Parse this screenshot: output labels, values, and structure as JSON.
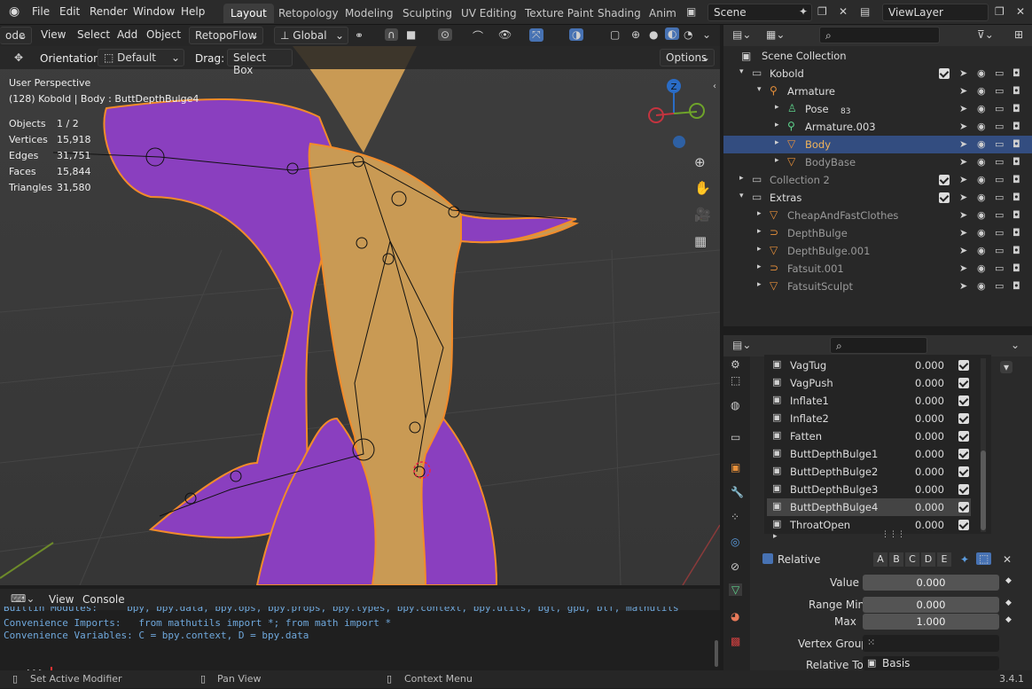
{
  "topbar": {
    "menus": [
      "File",
      "Edit",
      "Render",
      "Window",
      "Help"
    ],
    "workspaces": [
      "Layout",
      "Retopology",
      "Modeling",
      "Sculpting",
      "UV Editing",
      "Texture Paint",
      "Shading",
      "Anim"
    ],
    "active_workspace": "Layout",
    "scene": "Scene",
    "view_layer": "ViewLayer"
  },
  "viewport_header": {
    "mode": "ode",
    "view": "View",
    "select": "Select",
    "add": "Add",
    "object": "Object",
    "addon": "RetopoFlow",
    "transform_orientation": "Global"
  },
  "tool_settings": {
    "orientation_label": "Orientation:",
    "orientation_value": "Default",
    "drag_label": "Drag:",
    "drag_value": "Select Box",
    "options": "Options"
  },
  "viewport": {
    "perspective": "User Perspective",
    "context": "(128) Kobold | Body : ButtDepthBulge4",
    "stats": [
      {
        "label": "Objects",
        "value": "1 / 2"
      },
      {
        "label": "Vertices",
        "value": "15,918"
      },
      {
        "label": "Edges",
        "value": "31,751"
      },
      {
        "label": "Faces",
        "value": "15,844"
      },
      {
        "label": "Triangles",
        "value": "31,580"
      }
    ],
    "gizmo_axis": "Z"
  },
  "outliner": {
    "root": "Scene Collection",
    "rows": [
      {
        "label": "Kobold",
        "indent": 1,
        "icon": "collection-icon"
      },
      {
        "label": "Armature",
        "indent": 2,
        "icon": "armature-icon"
      },
      {
        "label": "Pose",
        "indent": 3,
        "icon": "pose-icon",
        "badge": "83"
      },
      {
        "label": "Armature.003",
        "indent": 3,
        "icon": "armature-data-icon"
      },
      {
        "label": "Body",
        "indent": 3,
        "icon": "mesh-icon",
        "selected": true
      },
      {
        "label": "BodyBase",
        "indent": 3,
        "icon": "mesh-icon"
      },
      {
        "label": "Collection 2",
        "indent": 1,
        "icon": "collection-icon"
      },
      {
        "label": "Extras",
        "indent": 1,
        "icon": "collection-icon"
      },
      {
        "label": "CheapAndFastClothes",
        "indent": 2,
        "icon": "mesh-icon"
      },
      {
        "label": "DepthBulge",
        "indent": 2,
        "icon": "curve-icon"
      },
      {
        "label": "DepthBulge.001",
        "indent": 2,
        "icon": "mesh-icon"
      },
      {
        "label": "Fatsuit.001",
        "indent": 2,
        "icon": "curve-icon"
      },
      {
        "label": "FatsuitSculpt",
        "indent": 2,
        "icon": "mesh-icon"
      }
    ]
  },
  "shape_keys": {
    "rows": [
      {
        "name": "VagTug",
        "value": "0.000"
      },
      {
        "name": "VagPush",
        "value": "0.000"
      },
      {
        "name": "Inflate1",
        "value": "0.000"
      },
      {
        "name": "Inflate2",
        "value": "0.000"
      },
      {
        "name": "Fatten",
        "value": "0.000"
      },
      {
        "name": "ButtDepthBulge1",
        "value": "0.000"
      },
      {
        "name": "ButtDepthBulge2",
        "value": "0.000"
      },
      {
        "name": "ButtDepthBulge3",
        "value": "0.000"
      },
      {
        "name": "ButtDepthBulge4",
        "value": "0.000",
        "selected": true
      },
      {
        "name": "ThroatOpen",
        "value": "0.000"
      }
    ],
    "relative_label": "Relative",
    "letters": [
      "A",
      "B",
      "C",
      "D",
      "E"
    ],
    "value_label": "Value",
    "value": "0.000",
    "range_min_label": "Range Min",
    "range_min": "0.000",
    "max_label": "Max",
    "max": "1.000",
    "vertex_group_label": "Vertex Group",
    "relative_to_label": "Relative To",
    "relative_to": "Basis"
  },
  "console": {
    "view": "View",
    "console": "Console",
    "lines": [
      "Builtin Modules:     bpy, bpy.data, bpy.ops, bpy.props, bpy.types, bpy.context, bpy.utils, bgl, gpu, blf, mathutils",
      "Convenience Imports:   from mathutils import *; from math import *",
      "Convenience Variables: C = bpy.context, D = bpy.data"
    ],
    "prompt": ">>> "
  },
  "statusbar": {
    "left": "Set Active Modifier",
    "middle": "Pan View",
    "right": "Context Menu",
    "version": "3.4.1"
  }
}
